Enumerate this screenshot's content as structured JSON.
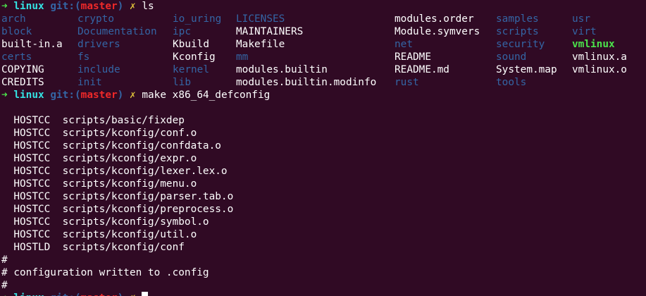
{
  "prompt": {
    "arrow": "➜",
    "dir": "linux",
    "git_prefix": "git:(",
    "branch": "master",
    "git_suffix": ")",
    "dirty": "✗"
  },
  "commands": [
    "ls",
    "make x86_64_defconfig"
  ],
  "ls": {
    "columns": [
      [
        {
          "name": "arch",
          "type": "dir"
        },
        {
          "name": "block",
          "type": "dir"
        },
        {
          "name": "built-in.a",
          "type": "file"
        },
        {
          "name": "certs",
          "type": "dir"
        },
        {
          "name": "COPYING",
          "type": "file"
        },
        {
          "name": "CREDITS",
          "type": "file"
        }
      ],
      [
        {
          "name": "crypto",
          "type": "dir"
        },
        {
          "name": "Documentation",
          "type": "dir"
        },
        {
          "name": "drivers",
          "type": "dir"
        },
        {
          "name": "fs",
          "type": "dir"
        },
        {
          "name": "include",
          "type": "dir"
        },
        {
          "name": "init",
          "type": "dir"
        }
      ],
      [
        {
          "name": "io_uring",
          "type": "dir"
        },
        {
          "name": "ipc",
          "type": "dir"
        },
        {
          "name": "Kbuild",
          "type": "file"
        },
        {
          "name": "Kconfig",
          "type": "file"
        },
        {
          "name": "kernel",
          "type": "dir"
        },
        {
          "name": "lib",
          "type": "dir"
        }
      ],
      [
        {
          "name": "LICENSES",
          "type": "dir"
        },
        {
          "name": "MAINTAINERS",
          "type": "file"
        },
        {
          "name": "Makefile",
          "type": "file"
        },
        {
          "name": "mm",
          "type": "dir"
        },
        {
          "name": "modules.builtin",
          "type": "file"
        },
        {
          "name": "modules.builtin.modinfo",
          "type": "file"
        }
      ],
      [
        {
          "name": "modules.order",
          "type": "file"
        },
        {
          "name": "Module.symvers",
          "type": "file"
        },
        {
          "name": "net",
          "type": "dir"
        },
        {
          "name": "README",
          "type": "file"
        },
        {
          "name": "README.md",
          "type": "file"
        },
        {
          "name": "rust",
          "type": "dir"
        }
      ],
      [
        {
          "name": "samples",
          "type": "dir"
        },
        {
          "name": "scripts",
          "type": "dir"
        },
        {
          "name": "security",
          "type": "dir"
        },
        {
          "name": "sound",
          "type": "dir"
        },
        {
          "name": "System.map",
          "type": "file"
        },
        {
          "name": "tools",
          "type": "dir"
        }
      ],
      [
        {
          "name": "usr",
          "type": "dir"
        },
        {
          "name": "virt",
          "type": "dir"
        },
        {
          "name": "vmlinux",
          "type": "exec"
        },
        {
          "name": "vmlinux.a",
          "type": "file"
        },
        {
          "name": "vmlinux.o",
          "type": "file"
        }
      ]
    ]
  },
  "make_output": [
    "",
    "  HOSTCC  scripts/basic/fixdep",
    "  HOSTCC  scripts/kconfig/conf.o",
    "  HOSTCC  scripts/kconfig/confdata.o",
    "  HOSTCC  scripts/kconfig/expr.o",
    "  HOSTCC  scripts/kconfig/lexer.lex.o",
    "  HOSTCC  scripts/kconfig/menu.o",
    "  HOSTCC  scripts/kconfig/parser.tab.o",
    "  HOSTCC  scripts/kconfig/preprocess.o",
    "  HOSTCC  scripts/kconfig/symbol.o",
    "  HOSTCC  scripts/kconfig/util.o",
    "  HOSTLD  scripts/kconfig/conf",
    "#",
    "# configuration written to .config",
    "#"
  ],
  "colors": {
    "background": "#300a24",
    "arrow": "#4be34b",
    "dir_name": "#34e2e2",
    "git": "#3465a4",
    "branch": "#ef2929",
    "dirty": "#e0c33a",
    "directory": "#3465a4",
    "executable": "#4be34b"
  }
}
